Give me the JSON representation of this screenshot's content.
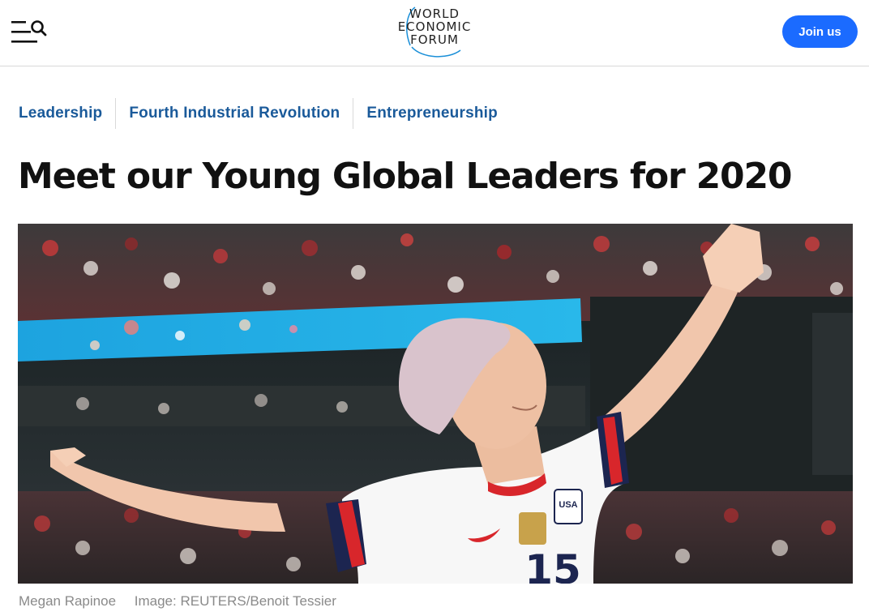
{
  "header": {
    "logo": {
      "line1": "WORLD",
      "line2": "ECONOMIC",
      "line3": "FORUM"
    },
    "menu_icon": "menu-search-icon",
    "join_label": "Join us",
    "join_color": "#1b6bff"
  },
  "topics": [
    "Leadership",
    "Fourth Industrial Revolution",
    "Entrepreneurship"
  ],
  "topic_color": "#1a5a9a",
  "article": {
    "title": "Meet our Young Global Leaders for 2020",
    "caption_subject": "Megan Rapinoe",
    "caption_credit": "Image: REUTERS/Benoit Tessier",
    "jersey_number": "15",
    "crest_text": "USA"
  }
}
